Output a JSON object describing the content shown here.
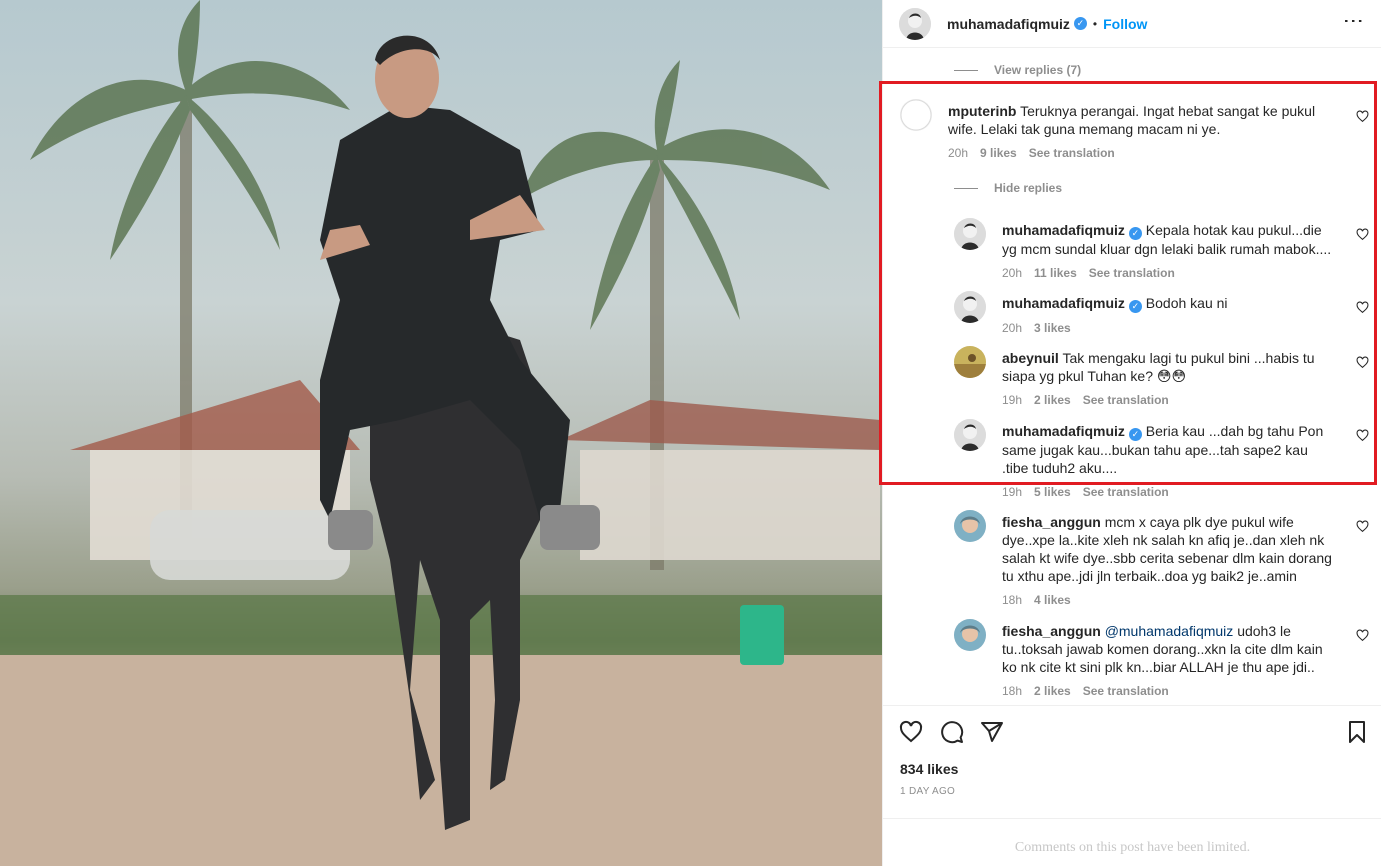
{
  "post": {
    "username": "muhamadafiqmuiz",
    "follow_label": "Follow",
    "dot": "•",
    "more_label": "⋮",
    "likes": "834 likes",
    "time_ago": "1 DAY AGO",
    "limited_notice": "Comments on this post have been limited."
  },
  "view_replies": "View replies (7)",
  "hide_replies": "Hide replies",
  "comments": [
    {
      "username": "mputerinb",
      "text": "Teruknya perangai. Ingat hebat sangat ke pukul wife. Lelaki tak guna memang macam ni ye.",
      "time": "20h",
      "likes": "9 likes",
      "translate": "See translation"
    },
    {
      "username": "muhamadafiqmuiz",
      "text": "Kepala hotak kau pukul...die yg mcm sundal kluar dgn lelaki balik rumah mabok....",
      "time": "20h",
      "likes": "11 likes",
      "translate": "See translation"
    },
    {
      "username": "muhamadafiqmuiz",
      "text": "Bodoh kau ni",
      "time": "20h",
      "likes": "3 likes"
    },
    {
      "username": "abeynuil",
      "text": "Tak mengaku lagi tu pukul bini ...habis tu siapa yg pkul Tuhan ke? 😳😳",
      "time": "19h",
      "likes": "2 likes",
      "translate": "See translation"
    },
    {
      "username": "muhamadafiqmuiz",
      "text": "Beria kau ...dah bg tahu Pon same jugak kau...bukan tahu ape...tah sape2 kau .tibe tuduh2 aku....",
      "time": "19h",
      "likes": "5 likes",
      "translate": "See translation"
    },
    {
      "username": "fiesha_anggun",
      "text": "mcm x caya plk dye pukul wife dye..xpe la..kite xleh nk salah kn afiq je..dan xleh nk salah kt wife dye..sbb cerita sebenar dlm kain dorang tu xthu ape..jdi jln terbaik..doa yg baik2 je..amin",
      "time": "18h",
      "likes": "4 likes"
    },
    {
      "username": "fiesha_anggun",
      "mention": "@muhamadafiqmuiz",
      "text": "udoh3 le tu..toksah jawab komen dorang..xkn la cite dlm kain ko nk cite kt sini plk kn...biar ALLAH je thu ape jdi..",
      "time": "18h",
      "likes": "2 likes",
      "translate": "See translation"
    }
  ],
  "colors": {
    "follow": "#0095f6",
    "verified": "#3897f0",
    "highlight": "#e11b22",
    "meta": "#8e8e8e"
  },
  "icons": [
    "heart-icon",
    "comment-icon",
    "share-icon",
    "bookmark-icon",
    "more-icon",
    "verified-icon"
  ]
}
